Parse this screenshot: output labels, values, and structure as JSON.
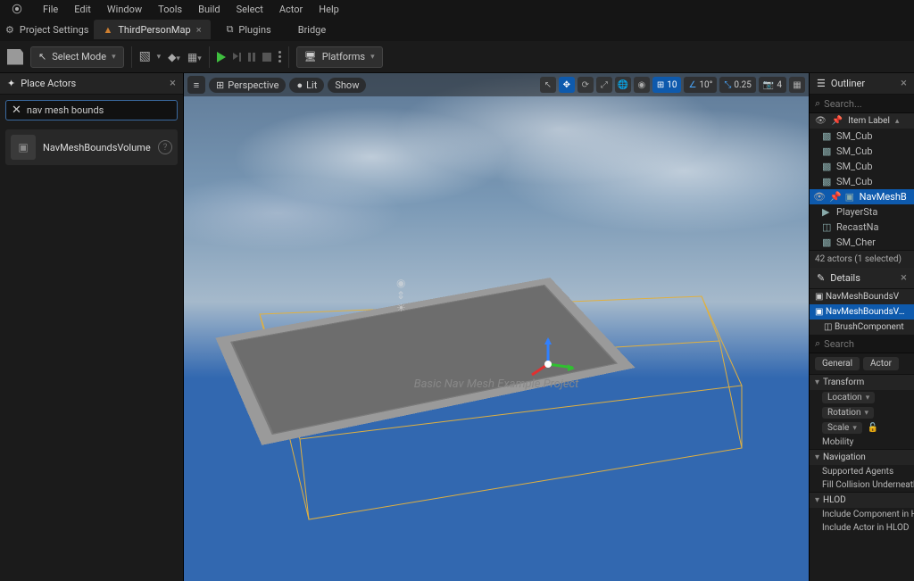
{
  "menu": {
    "items": [
      "File",
      "Edit",
      "Window",
      "Tools",
      "Build",
      "Select",
      "Actor",
      "Help"
    ]
  },
  "tabs": {
    "project_settings": "Project Settings",
    "map_name": "ThirdPersonMap",
    "plugins": "Plugins",
    "bridge": "Bridge"
  },
  "main_toolbar": {
    "select_mode": "Select Mode",
    "platforms": "Platforms"
  },
  "place_actors": {
    "title": "Place Actors",
    "search_value": "nav mesh bounds",
    "result_name": "NavMeshBoundsVolume"
  },
  "viewport": {
    "perspective": "Perspective",
    "lit": "Lit",
    "show": "Show",
    "snap_grid": "10",
    "snap_angle": "10°",
    "snap_scale": "0.25",
    "camera_speed": "4",
    "project_text": "Basic Nav Mesh Example Project"
  },
  "outliner": {
    "title": "Outliner",
    "search_placeholder": "Search...",
    "column": "Item Label",
    "items": [
      {
        "name": "SM_Cub",
        "icon": "cube",
        "sel": false
      },
      {
        "name": "SM_Cub",
        "icon": "cube",
        "sel": false
      },
      {
        "name": "SM_Cub",
        "icon": "cube",
        "sel": false
      },
      {
        "name": "SM_Cub",
        "icon": "cube",
        "sel": false
      },
      {
        "name": "NavMeshB",
        "icon": "vol",
        "sel": true
      },
      {
        "name": "PlayerSta",
        "icon": "pawn",
        "sel": false
      },
      {
        "name": "RecastNa",
        "icon": "nav",
        "sel": false
      },
      {
        "name": "SM_Cher",
        "icon": "cube",
        "sel": false
      }
    ],
    "footer": "42 actors (1 selected)"
  },
  "details": {
    "title": "Details",
    "asset_name": "NavMeshBoundsV",
    "component_row": "NavMeshBoundsVolum",
    "child_component": "BrushComponent",
    "search_placeholder": "Search",
    "tabs": [
      "General",
      "Actor"
    ],
    "transform": {
      "title": "Transform",
      "location": "Location",
      "rotation": "Rotation",
      "scale": "Scale",
      "mobility": "Mobility"
    },
    "navigation": {
      "title": "Navigation",
      "supported": "Supported Agents",
      "fill": "Fill Collision Underneath fo"
    },
    "hlod": {
      "title": "HLOD",
      "include_comp": "Include Component in HLOD",
      "include_actor": "Include Actor in HLOD"
    }
  }
}
